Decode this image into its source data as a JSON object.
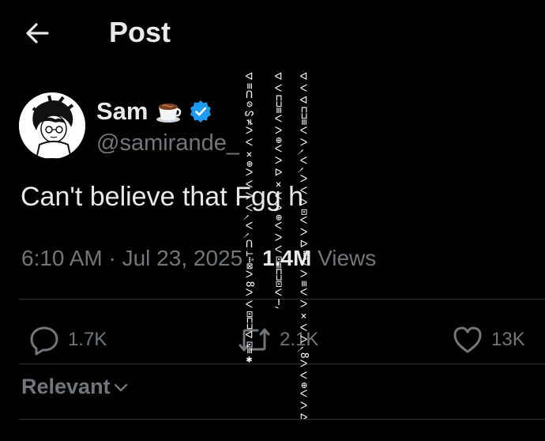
{
  "header": {
    "title": "Post",
    "back_icon": "arrow-left-icon"
  },
  "author": {
    "name": "Sam",
    "emoji_icon": "coffee-cup-icon",
    "verified_icon": "verified-badge-icon",
    "verified_color": "#1d9bf0",
    "handle": "@samirande_"
  },
  "tweet": {
    "text": "Can't believe that Fgg h",
    "time": "6:10 AM · Jul 23, 2025 ·",
    "views_count": "1.4M",
    "views_label": "Views"
  },
  "actions": {
    "replies": "1.7K",
    "reposts": "2.1K",
    "likes": "13K"
  },
  "sort": {
    "label": "Relevant"
  },
  "glitch": {
    "col1": "ᐊ≡ᑎ⊘ᔕ≠ᐳᐸ×⊕ᐳᐸᐳᐸ৲ᐸ৲ᑎ⊥⋯⊠ᐳ8ᐳᐸ⊡⊏⊐ᐊ⊡≡✱ᐅ",
    "col2": "ᐊᐸ⊏⊐≡ᐸᐳ⊕ᐸᐳᐅ×ᐸᐳ⊕ᐸᐳᐸ⊡≡⊏⊐⊡ᐸ⋯ᐳᐸ⋯ᐊᐸ",
    "col3": "ᐊᐸᐊ⊏⊐≡ᐸᐳ৲ᐸ৲ᐳᐸᐳ⊡ᐸᐳᐅ⋯ᐸᐳ≡ᐸᐳ×ᐸᐳ৲8ᐳᐸ⊕ᐸᐳᐅ×ᐸᐳ⊡ᐸᐳ⊥"
  },
  "colors": {
    "background": "#000000",
    "text": "#e7e9ea",
    "muted": "#71767b",
    "divider": "#2f3336"
  }
}
